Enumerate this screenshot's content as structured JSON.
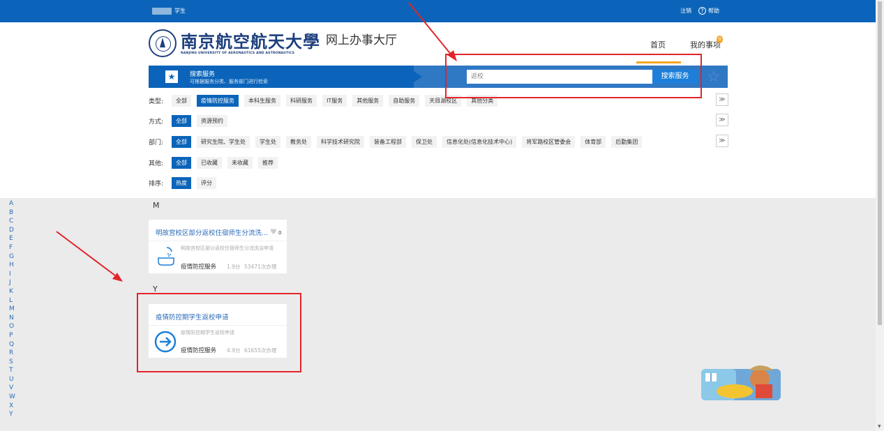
{
  "topbar": {
    "user_role": "学生",
    "logout": "注销",
    "help_icon": "?",
    "help": "帮助"
  },
  "header": {
    "school_cn": "南京航空航天大學",
    "school_en": "NANJING UNIVERSITY OF AERONAUTICS AND ASTRONAUTICS",
    "hall": "网上办事大厅",
    "nav_home": "首页",
    "nav_mine": "我的事项",
    "badge": "0"
  },
  "banner": {
    "title": "搜索服务",
    "subtitle": "可根据服务分类、服务部门进行检索",
    "search_value": "返校",
    "search_button": "搜索服务"
  },
  "filters": {
    "type": {
      "label": "类型:",
      "tags": [
        "全部",
        "疫情防控服务",
        "本科生服务",
        "科研服务",
        "IT服务",
        "其他服务",
        "自助服务",
        "天目湖校区",
        "其他分类"
      ]
    },
    "mode": {
      "label": "方式:",
      "tags": [
        "全部",
        "资源预约"
      ]
    },
    "dept": {
      "label": "部门:",
      "tags": [
        "全部",
        "研究生院、学生处",
        "学生处",
        "教务处",
        "科学技术研究院",
        "装备工程部",
        "保卫处",
        "信息化处(信息化技术中心)",
        "将军路校区管委会",
        "体育部",
        "后勤集团"
      ]
    },
    "other": {
      "label": "其他:",
      "tags": [
        "全部",
        "已收藏",
        "未收藏",
        "推荐"
      ]
    },
    "sort": {
      "label": "排序:",
      "tags": [
        "热度",
        "评分"
      ]
    }
  },
  "letters": [
    "A",
    "B",
    "C",
    "D",
    "E",
    "F",
    "G",
    "H",
    "I",
    "J",
    "K",
    "L",
    "M",
    "N",
    "O",
    "P",
    "Q",
    "R",
    "S",
    "T",
    "U",
    "V",
    "W",
    "X",
    "Y"
  ],
  "sections": [
    {
      "letter": "M",
      "card": {
        "title": "明故宫校区部分返校住宿师生分流洗...",
        "likes": "0",
        "desc": "明故宫校区部分返校住宿师生分流洗浴申请",
        "category": "疫情防控服务",
        "score": "1.9分",
        "count": "53471次办理"
      }
    },
    {
      "letter": "Y",
      "card": {
        "title": "疫情防控期学生返校申请",
        "desc": "疫情防控期学生返校申请",
        "category": "疫情防控服务",
        "score": "4.9分",
        "count": "61655次办理"
      }
    }
  ],
  "colors": {
    "primary": "#0b64b9",
    "accent": "#f5a623",
    "annotation": "#e3242b"
  }
}
